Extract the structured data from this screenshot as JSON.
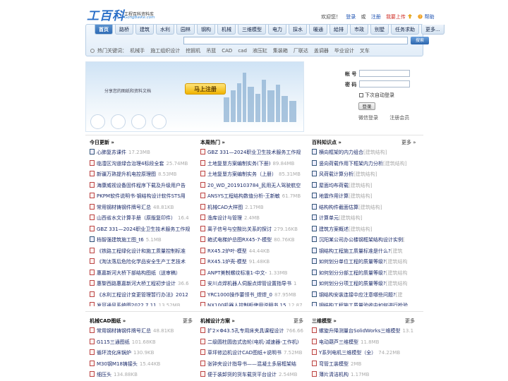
{
  "header": {
    "logo": "工百科",
    "logo_sub": "工程百科资料库",
    "logo_url": "GongBaike.com",
    "welcome": "欢迎您！",
    "login": "登录",
    "or": "或",
    "register": "注册",
    "upload": "我要上传",
    "help": "帮助"
  },
  "nav": {
    "items": [
      "首页",
      "路桥",
      "建筑",
      "水利",
      "园林",
      "钢构",
      "机械",
      "三维模型",
      "电力",
      "採水",
      "暖通",
      "給排",
      "市政",
      "别墅",
      "任务求助",
      "更多..."
    ],
    "search_button": "搜索",
    "hot_label": "热门关键词：",
    "hot_keywords": [
      "机械手",
      "施工组织设计",
      "挖掘机",
      "吊篮",
      "CAD",
      "cad",
      "液压缸",
      "集装箱",
      "厂联达",
      "盖调器",
      "毕业设计",
      "叉车"
    ]
  },
  "banner": {
    "text": "分享您的图纸和资料文档",
    "register_button": "马上注册"
  },
  "login_box": {
    "account_label": "帐 号",
    "password_label": "密 码",
    "remember": "下次自动登录",
    "login_button": "登录",
    "wechat_login": "微信登录",
    "member_register": "注册会员"
  },
  "sections": {
    "today": {
      "title": "今日更新 »",
      "items": [
        {
          "title": "心肺复苏课件",
          "size": "17.23MB",
          "icon": "doc"
        },
        {
          "title": "临澧区沟道绿合治理4标段全套",
          "size": "25.74MB",
          "icon": "pdf"
        },
        {
          "title": "新疆万熟提升机电控原理图",
          "size": "8.53MB",
          "icon": "pdf"
        },
        {
          "title": "海康威视设备固件程序下载及升级用户告",
          "size": "",
          "icon": "pdf"
        },
        {
          "title": "PKPM软件说明书-钢结构设计软件STS用",
          "size": "",
          "icon": "pdf"
        },
        {
          "title": "常用钢材铸钢件牌号汇总",
          "size": "48.81KB",
          "icon": "pdf"
        },
        {
          "title": "山西省水文计算手册（原版复印件）",
          "size": "16.4",
          "icon": "pdf"
        },
        {
          "title": "GBZ 331—2024职业卫生技术服务工作规",
          "size": "",
          "icon": "pdf"
        },
        {
          "title": "档智强建筑施工图_t6",
          "size": "5.1MB",
          "icon": "doc"
        },
        {
          "title": "《铁路工程绿化设计和施工质量控制标准",
          "size": "",
          "icon": "pdf"
        },
        {
          "title": "《淘汰落后危险化学品安全生产工艺技术",
          "size": "",
          "icon": "pdf"
        },
        {
          "title": "惠嘉新河大桥下部结构图纸（送审稿）",
          "size": "",
          "icon": "pdf"
        },
        {
          "title": "惠黎西路惠嘉新河大桥工程初步设计",
          "size": "36.6",
          "icon": "pdf"
        },
        {
          "title": "《水利工程设计变更管理暂行办法》2012",
          "size": "",
          "icon": "pdf"
        },
        {
          "title": "发耳通风系统图2022.7.11",
          "size": "13.52MB",
          "icon": "pdf"
        }
      ]
    },
    "hot": {
      "title": "本周热门 »",
      "items": [
        {
          "title": "GBZ 331—2024职业卫生技术服务工作规",
          "size": "",
          "icon": "pdf"
        },
        {
          "title": "土地复垦方案编制实务(下册)",
          "size": "89.84MB",
          "icon": "pdf"
        },
        {
          "title": "土地复垦方案编制实务（上册）",
          "size": "85.31MB",
          "icon": "pdf"
        },
        {
          "title": "20_WD_2019103784_民用无人驾驶航空",
          "size": "",
          "icon": "pdf"
        },
        {
          "title": "ANSYS工程结构数值分析-王新敏",
          "size": "61.7MB",
          "icon": "pdf"
        },
        {
          "title": "机械CAD大样图",
          "size": "2.17MB",
          "icon": "pdf"
        },
        {
          "title": "渔库设计与管理",
          "size": "2.4MB",
          "icon": "pdf"
        },
        {
          "title": "离子信号与空酸比关系的探讨",
          "size": "279.16KB",
          "icon": "pdf"
        },
        {
          "title": "箱式电梯炉总图RX45-7-模型",
          "size": "80.76KB",
          "icon": "pdf"
        },
        {
          "title": "RX45.2炉叶-模型",
          "size": "44.44KB",
          "icon": "pdf"
        },
        {
          "title": "RX45.1炉壳-模型",
          "size": "91.48KB",
          "icon": "pdf"
        },
        {
          "title": "ANPT美制螺纹标准1-中文-",
          "size": "1.33MB",
          "icon": "pdf"
        },
        {
          "title": "安川点焊机器人伺服点焊管设置指导书",
          "size": "1",
          "icon": "pdf"
        },
        {
          "title": "YRC1000操作要领书_焊焊_0",
          "size": "87.95MB",
          "icon": "pdf"
        },
        {
          "title": "NX100机器人控制柜使用说明书.15",
          "size": "12.87",
          "icon": "pdf"
        }
      ]
    },
    "wiki": {
      "title": "百科知识点 »",
      "more": "更多",
      "items": [
        {
          "title": "横向框架的内力组合",
          "tag": "[建筑结构]"
        },
        {
          "title": "竖向荷载作用下框架内力分析",
          "tag": "[建筑结构]"
        },
        {
          "title": "风荷载计算分析",
          "tag": "[建筑结构]"
        },
        {
          "title": "屋面均布荷载",
          "tag": "[建筑结构]"
        },
        {
          "title": "地震作用计算",
          "tag": "[建筑结构]"
        },
        {
          "title": "结构构件截面估算",
          "tag": "[建筑结构]"
        },
        {
          "title": "计算单元",
          "tag": "[建筑结构]"
        },
        {
          "title": "建筑方案概述",
          "tag": "[建筑结构]"
        },
        {
          "title": "沉阳某公司办公楼钢框架结构设计实例",
          "tag": "["
        },
        {
          "title": "钢结构工程施工质量标准是什么?",
          "tag": "[建筑"
        },
        {
          "title": "如何划分单位工程的质量等级?",
          "tag": "[建筑结构"
        },
        {
          "title": "如何划分分部工程的质量等级?",
          "tag": "[建筑结构"
        },
        {
          "title": "如何划分分项工程的质量等级?",
          "tag": "[建筑结构"
        },
        {
          "title": "钢结构安装连接中应注意哪些问题?",
          "tag": "[建"
        },
        {
          "title": "钢结构工程施工质量验收中如何进行检验",
          "tag": ""
        }
      ]
    },
    "cad": {
      "title": "机械CAD图纸 »",
      "more": "更多",
      "items": [
        {
          "title": "常用钢材铸钢件牌号汇总",
          "size": "48.81KB"
        },
        {
          "title": "G115三通图纸",
          "size": "101.68KB"
        },
        {
          "title": "循环流化床锅炉",
          "size": "130.9KB"
        },
        {
          "title": "M30钢M18铸接头",
          "size": "15.44KB"
        },
        {
          "title": "细压头",
          "size": "134.88KB"
        }
      ]
    },
    "design": {
      "title": "机械设计方案 »",
      "more": "更多",
      "items": [
        {
          "title": "扩2×Φ43.5孔专用床夹具课程设计",
          "size": "766.66"
        },
        {
          "title": "二级圆柱圆齿式齿轮(电机-减速器-工作机)",
          "size": ""
        },
        {
          "title": "草坪修边机设计CAD图纸+说明书",
          "size": "7.52MB"
        },
        {
          "title": "张钟夹设计指导书——混凝土多层框架结",
          "size": ""
        },
        {
          "title": "便于装卸货的货车载货平台设计",
          "size": "2.54MB"
        }
      ]
    },
    "model": {
      "title": "三维模型 »",
      "more": "更多",
      "items": [
        {
          "title": "螺旋升降测量台SolidWorks三维模型",
          "size": "13.1"
        },
        {
          "title": "电动葫芦三维模型",
          "size": "11.8MB"
        },
        {
          "title": "Y系列电机三维模型（全）",
          "size": "74.22MB"
        },
        {
          "title": "弯管工装模型",
          "size": "2MB"
        },
        {
          "title": "薄片清洁机构",
          "size": "1.17MB"
        }
      ]
    }
  }
}
